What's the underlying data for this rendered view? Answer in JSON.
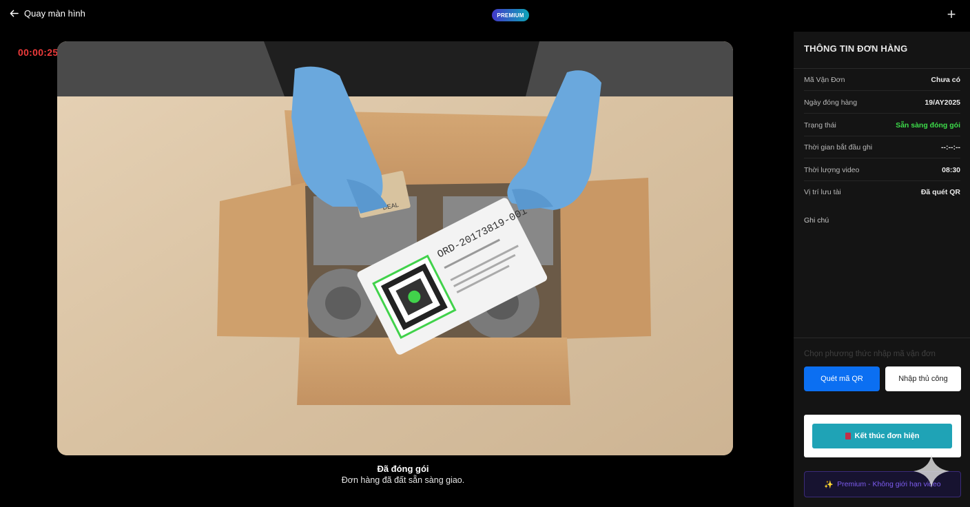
{
  "topbar": {
    "back_label": "Quay màn hình",
    "premium_badge": "PREMIUM",
    "plus_icon": "+"
  },
  "timer": "00:00:25",
  "video": {
    "scene": "packing-box-with-qr-label",
    "label_code": "ORD-20173819-001",
    "small_card_text": "DEAL"
  },
  "caption": {
    "title": "Đã đóng gói",
    "subtitle": "Đơn hàng đã đất sẵn sàng giao."
  },
  "panel": {
    "title": "THÔNG TIN ĐƠN HÀNG",
    "rows": [
      {
        "label": "Mã Vận Đơn",
        "value": "Chưa có"
      },
      {
        "label": "Ngày đóng hàng",
        "value": "19/AY2025"
      },
      {
        "label": "Trạng thái",
        "value": "Sẵn sàng đóng gói",
        "color": "#3ddc4a"
      },
      {
        "label": "Thời gian bắt đầu ghi",
        "value": "--:--:--"
      },
      {
        "label": "Thời lượng video",
        "value": "08:30"
      },
      {
        "label": "Vị trí lưu tài",
        "value": "Đã quét QR"
      }
    ],
    "note_label": "Ghi chú",
    "choose_label": "Chọn phương thức nhập mã vận đơn",
    "btn_qr": "Quét mã QR",
    "btn_manual": "Nhập thủ công",
    "btn_end": "Kết thúc đơn hiện",
    "premium_bar": "Premium - Không giới hạn video"
  },
  "colors": {
    "accent_blue": "#0b6ff2",
    "teal": "#1fa3b6",
    "timer_red": "#ef3b3b",
    "status_green": "#3ddc4a",
    "premium_purple": "#7d5cf0"
  }
}
